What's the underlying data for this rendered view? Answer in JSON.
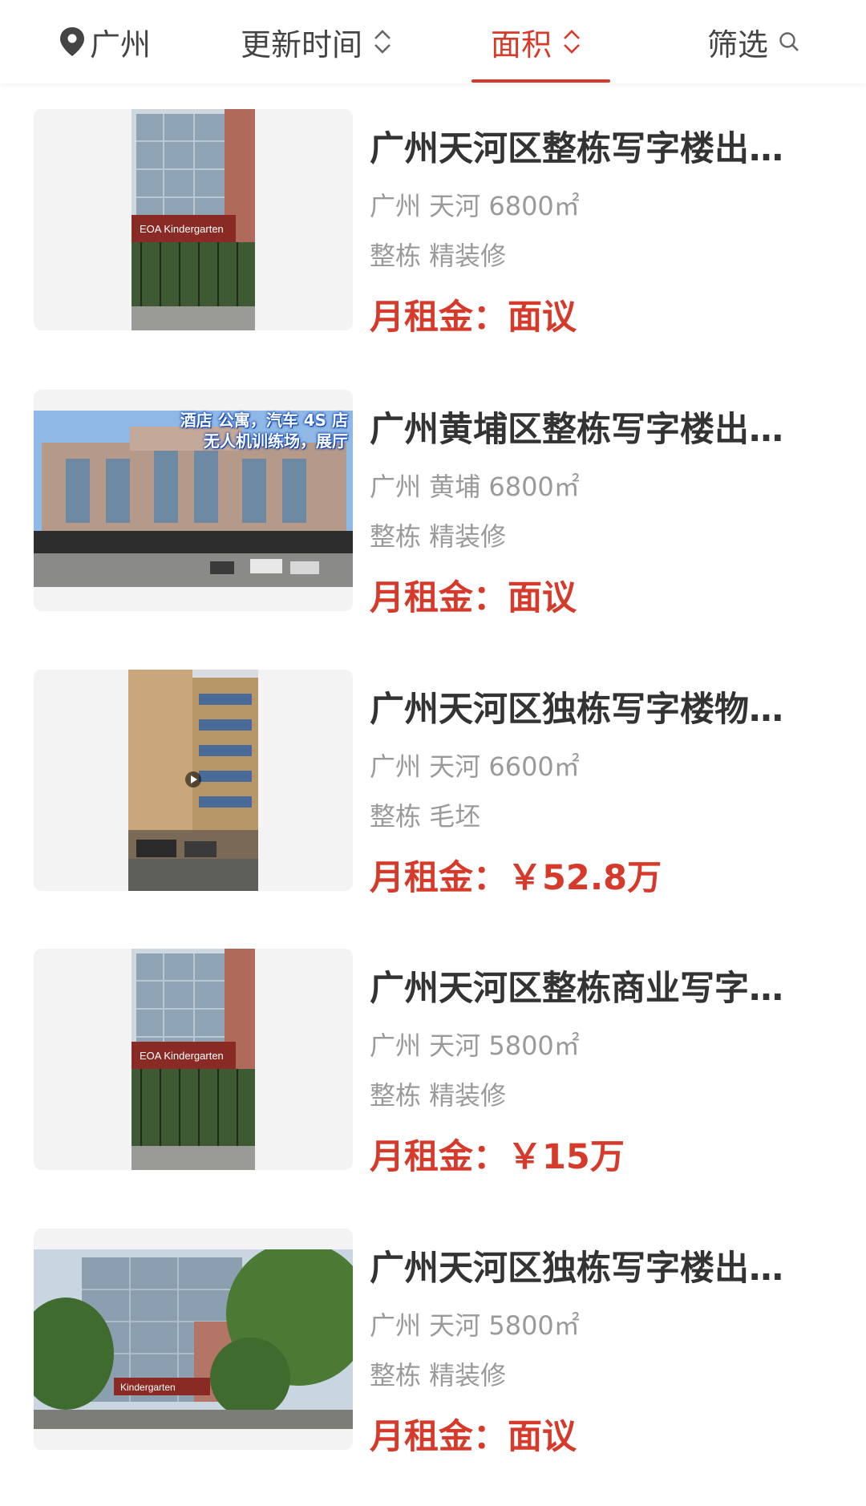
{
  "filters": {
    "city": "广州",
    "update_time": "更新时间",
    "area": "面积",
    "filter": "筛选"
  },
  "colors": {
    "accent": "#d63a2a",
    "title": "#333333",
    "meta": "#9a9a9a"
  },
  "listings": [
    {
      "title": "广州天河区整栋写字楼出…",
      "location": "广州 天河 6800㎡",
      "tags": "整栋 精装修",
      "price_label": "月租金：",
      "price_value": "面议",
      "thumb": "glass-tower-kindergarten"
    },
    {
      "title": "广州黄埔区整栋写字楼出…",
      "location": "广州 黄埔 6800㎡",
      "tags": "整栋 精装修",
      "price_label": "月租金：",
      "price_value": "面议",
      "thumb": "wide-building-with-caption",
      "overlay_line1": "酒店 公寓，汽车 4S 店",
      "overlay_line2": "无人机训练场，展厅"
    },
    {
      "title": "广州天河区独栋写字楼物…",
      "location": "广州 天河 6600㎡",
      "tags": "整栋 毛坯",
      "price_label": "月租金：",
      "price_value": "￥52.8万",
      "thumb": "tan-tower-video"
    },
    {
      "title": "广州天河区整栋商业写字…",
      "location": "广州 天河 5800㎡",
      "tags": "整栋 精装修",
      "price_label": "月租金：",
      "price_value": "￥15万",
      "thumb": "glass-tower-kindergarten"
    },
    {
      "title": "广州天河区独栋写字楼出…",
      "location": "广州 天河 5800㎡",
      "tags": "整栋 精装修",
      "price_label": "月租金：",
      "price_value": "面议",
      "thumb": "glass-tower-trees"
    }
  ]
}
